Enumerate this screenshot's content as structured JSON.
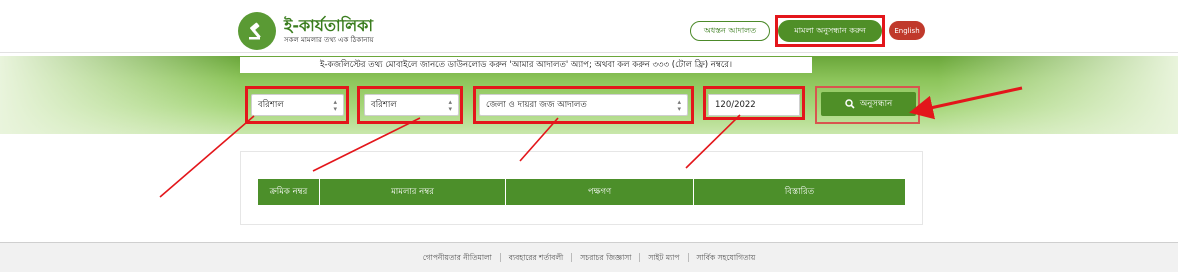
{
  "header": {
    "logo_title": "ই-কার্যতালিকা",
    "logo_subtitle": "সকল মামলার তথ্য এক ঠিকানায়",
    "btn_outline": "অধস্তন আদালত",
    "btn_search_case": "মামলা অনুসন্ধান করুন",
    "btn_english": "English"
  },
  "notice": "ই-কজলিস্টের তথ্য মোবাইলে জানতে ডাউনলোড করুন 'আমার আদালত' অ্যাপ; অথবা কল করুন ৩৩৩ (টোল ফ্রি) নম্বরে।",
  "search": {
    "division": "বরিশাল",
    "district": "বরিশাল",
    "court": "জেলা ও দায়রা জজ আদালত",
    "case_number": "120/2022",
    "search_label": "অনুসন্ধান"
  },
  "table": {
    "headers": [
      "ক্রমিক নম্বর",
      "মামলার নম্বর",
      "পক্ষগণ",
      "বিস্তারিত"
    ]
  },
  "footer": {
    "links": [
      "গোপনীয়তার নীতিমালা",
      "ব্যবহারের শর্তাবলী",
      "সচরাচর জিজ্ঞাসা",
      "সাইট ম্যাপ",
      "সার্বিক সহযোগিতায়"
    ]
  },
  "colors": {
    "brand_green": "#4f8f27",
    "annotation_red": "#e3161b",
    "english_button": "#c0392b"
  },
  "icons": [
    "gavel-icon",
    "search-icon",
    "select-arrows-icon"
  ]
}
